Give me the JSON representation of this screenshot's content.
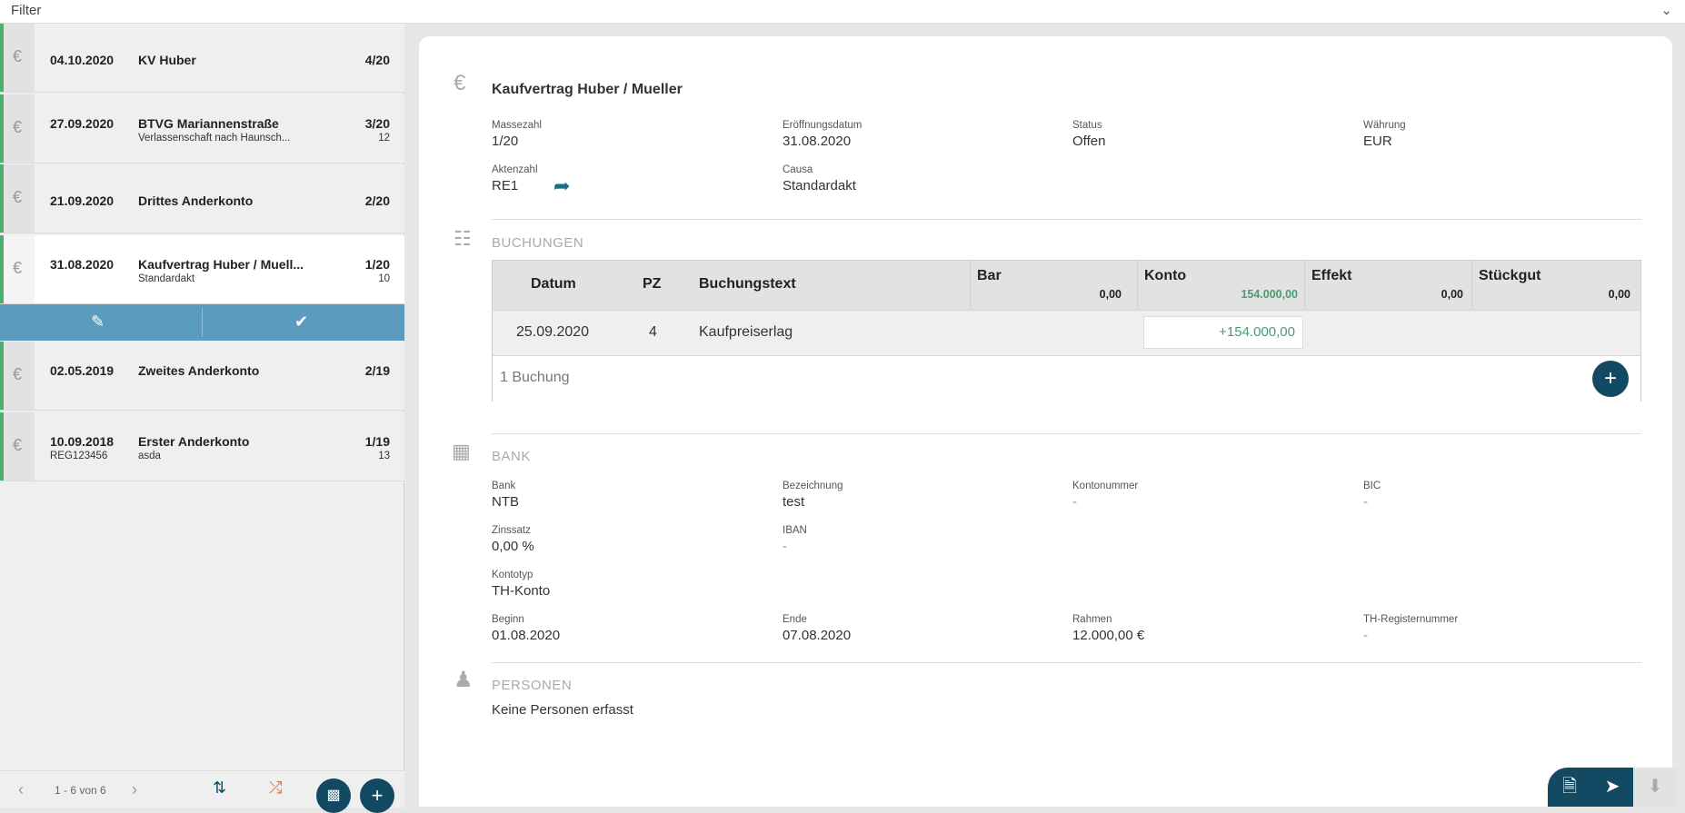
{
  "filter": {
    "label": "Filter"
  },
  "list": {
    "items": [
      {
        "date": "04.10.2020",
        "title": "KV Huber",
        "subtitle": "",
        "number": "4/20",
        "sub_number": "",
        "extra": ""
      },
      {
        "date": "27.09.2020",
        "title": "BTVG Mariannenstraße",
        "subtitle": "Verlassenschaft nach Haunsch...",
        "number": "3/20",
        "sub_number": "12",
        "extra": ""
      },
      {
        "date": "21.09.2020",
        "title": "Drittes Anderkonto",
        "subtitle": "",
        "number": "2/20",
        "sub_number": "",
        "extra": ""
      },
      {
        "date": "31.08.2020",
        "title": "Kaufvertrag Huber / Muell...",
        "subtitle": "Standardakt",
        "number": "1/20",
        "sub_number": "10",
        "extra": ""
      },
      {
        "date": "02.05.2019",
        "title": "Zweites Anderkonto",
        "subtitle": "",
        "number": "2/19",
        "sub_number": "",
        "extra": ""
      },
      {
        "date": "10.09.2018",
        "title": "Erster Anderkonto",
        "subtitle": "asda",
        "number": "1/19",
        "sub_number": "13",
        "extra": "REG123456"
      }
    ],
    "currency_symbol": "€"
  },
  "pager": {
    "range": "1 - 6 von 6"
  },
  "detail": {
    "title": "Kaufvertrag Huber / Mueller",
    "fields": {
      "massezahl_label": "Massezahl",
      "massezahl": "1/20",
      "eroeffnung_label": "Eröffnungsdatum",
      "eroeffnung": "31.08.2020",
      "status_label": "Status",
      "status": "Offen",
      "waehrung_label": "Währung",
      "waehrung": "EUR",
      "aktenzahl_label": "Aktenzahl",
      "aktenzahl": "RE1",
      "causa_label": "Causa",
      "causa": "Standardakt"
    },
    "buchungen": {
      "heading": "BUCHUNGEN",
      "columns": {
        "datum": "Datum",
        "pz": "PZ",
        "text": "Buchungstext",
        "bar": "Bar",
        "konto": "Konto",
        "effekt": "Effekt",
        "stueckgut": "Stückgut"
      },
      "totals": {
        "bar": "0,00",
        "konto": "154.000,00",
        "effekt": "0,00",
        "stueckgut": "0,00"
      },
      "rows": [
        {
          "datum": "25.09.2020",
          "pz": "4",
          "text": "Kaufpreiserlag",
          "konto": "+154.000,00"
        }
      ],
      "count": "1 Buchung"
    },
    "bank": {
      "heading": "BANK",
      "bank_label": "Bank",
      "bank": "NTB",
      "bez_label": "Bezeichnung",
      "bez": "test",
      "konto_label": "Kontonummer",
      "konto": "-",
      "bic_label": "BIC",
      "bic": "-",
      "zins_label": "Zinssatz",
      "zins": "0,00 %",
      "iban_label": "IBAN",
      "iban": "-",
      "typ_label": "Kontotyp",
      "typ": "TH-Konto",
      "beginn_label": "Beginn",
      "beginn": "01.08.2020",
      "ende_label": "Ende",
      "ende": "07.08.2020",
      "rahmen_label": "Rahmen",
      "rahmen": "12.000,00 €",
      "threg_label": "TH-Registernummer",
      "threg": "-"
    },
    "personen": {
      "heading": "PERSONEN",
      "empty": "Keine Personen erfasst"
    }
  },
  "colors": {
    "accent": "#124a63",
    "selection_bar": "#5b9bbd",
    "green": "#4caf6f",
    "positive": "#4a9a72"
  }
}
